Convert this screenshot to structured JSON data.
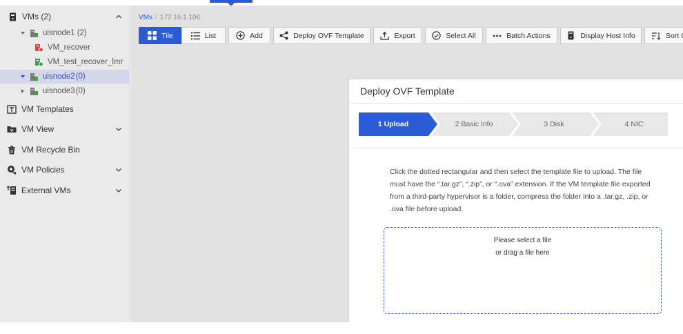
{
  "colors": {
    "accent": "#2b5cd6",
    "selected_bg": "#d3d7ea",
    "sidebar_bg": "#eaeaea",
    "main_bg": "#e1e1e1"
  },
  "sidebar": {
    "vms_header": {
      "label": "VMs (2)",
      "icon": "vm-icon"
    },
    "hosts": [
      {
        "label": "uisnode1",
        "count": "(2)",
        "expanded": true,
        "icon": "host-icon",
        "vms": [
          {
            "label": "VM_recover",
            "icon": "vm-stopped-icon"
          },
          {
            "label": "VM_test_recover_lmr",
            "icon": "vm-running-icon"
          }
        ]
      },
      {
        "label": "uisnode2",
        "count": "(0)",
        "expanded": true,
        "selected": true,
        "icon": "host-icon"
      },
      {
        "label": "uisnode3",
        "count": "(0)",
        "expanded": false,
        "icon": "host-icon"
      }
    ],
    "sections": [
      {
        "label": "VM Templates",
        "icon": "template-icon",
        "has_chevron": false
      },
      {
        "label": "VM View",
        "icon": "folder-icon",
        "has_chevron": true
      },
      {
        "label": "VM Recycle Bin",
        "icon": "trash-icon",
        "has_chevron": false
      },
      {
        "label": "VM Policies",
        "icon": "policy-icon",
        "has_chevron": true
      },
      {
        "label": "External VMs",
        "icon": "external-vm-icon",
        "has_chevron": true
      }
    ]
  },
  "breadcrumb": {
    "root": "VMs",
    "current": "172.16.1.106"
  },
  "toolbar": {
    "tile": "Tile",
    "list": "List",
    "add": "Add",
    "deploy_ovf": "Deploy OVF Template",
    "export": "Export",
    "select_all": "Select All",
    "batch_actions": "Batch Actions",
    "display_host_info": "Display Host Info",
    "sort": "Sort C"
  },
  "dialog": {
    "title": "Deploy OVF Template",
    "steps": [
      "1 Upload",
      "2 Basic Info",
      "3 Disk",
      "4 NIC"
    ],
    "active_step": 1,
    "instructions": "Click the dotted rectangular and then select the template file to upload. The file must have the “.tar.gz”, “.zip”, or “.ova” extension. If the VM template file exported from a third-party hypervisor is a folder, compress the folder into a .tar.gz, .zip, or .ova file before upload.",
    "dropzone_line1": "Please select a file",
    "dropzone_line2": "or drag a file here"
  }
}
